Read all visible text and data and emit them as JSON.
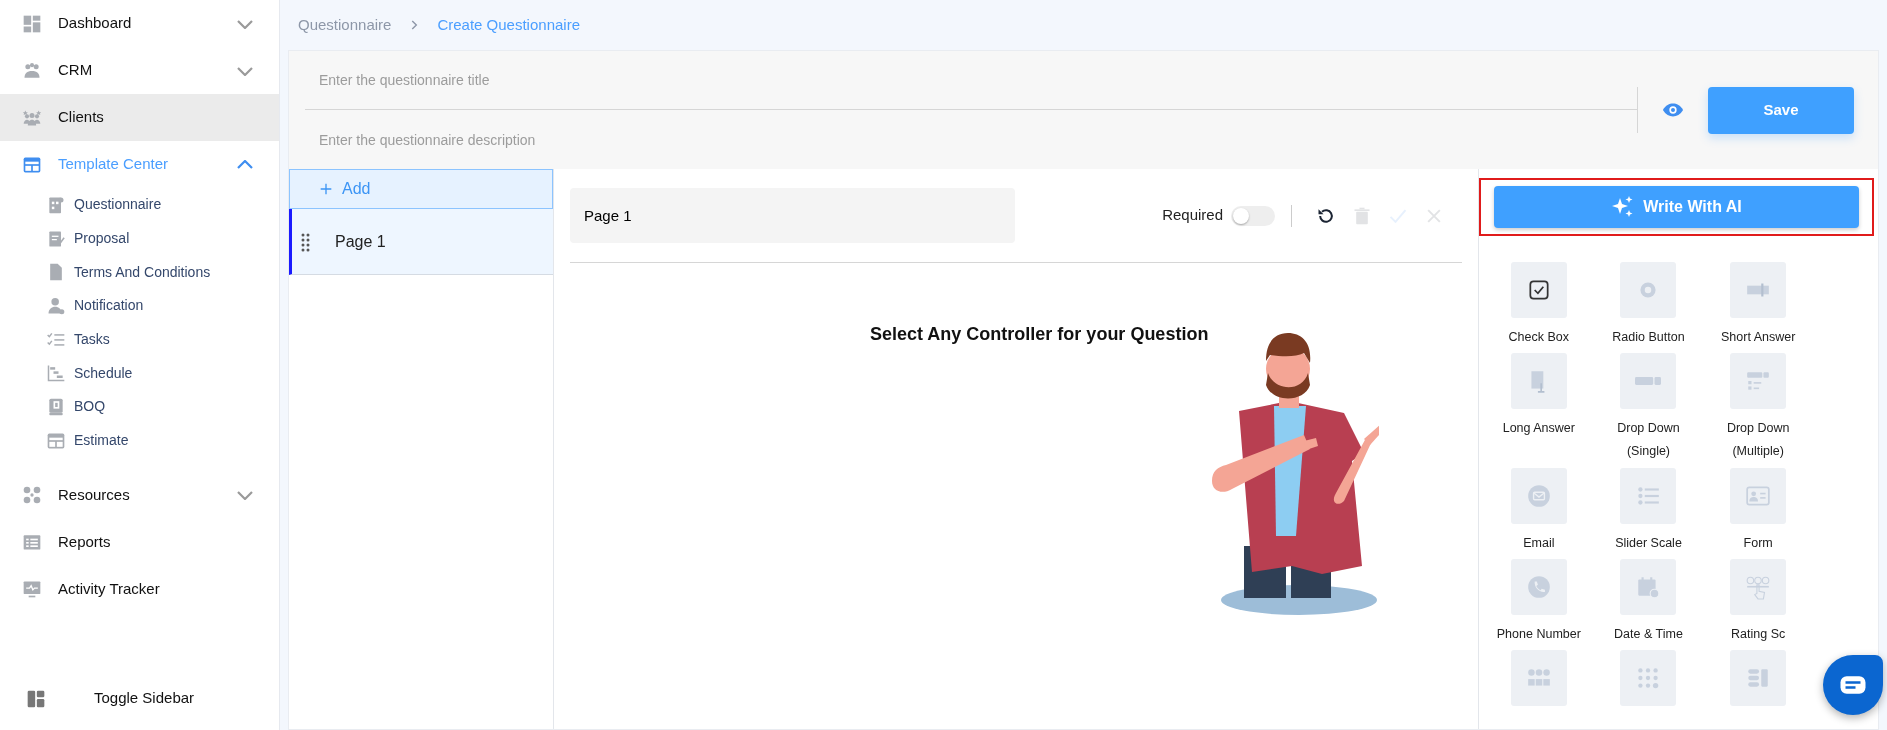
{
  "sidebar": {
    "items": [
      {
        "label": "Dashboard",
        "expanded": false,
        "selected": false
      },
      {
        "label": "CRM",
        "expanded": false,
        "selected": false
      },
      {
        "label": "Clients",
        "selected": true
      },
      {
        "label": "Template Center",
        "expanded": true,
        "selected": false,
        "children": [
          {
            "label": "Questionnaire",
            "selected": false
          },
          {
            "label": "Proposal",
            "selected": false
          },
          {
            "label": "Terms And Conditions",
            "selected": false
          },
          {
            "label": "Notification",
            "selected": false
          },
          {
            "label": "Tasks",
            "selected": false
          },
          {
            "label": "Schedule",
            "selected": false
          },
          {
            "label": "BOQ",
            "selected": false
          },
          {
            "label": "Estimate",
            "selected": false
          }
        ]
      },
      {
        "label": "Resources",
        "expanded": false,
        "selected": false
      },
      {
        "label": "Reports",
        "selected": false
      },
      {
        "label": "Activity Tracker",
        "selected": false
      }
    ],
    "toggle": {
      "label": "Toggle Sidebar"
    }
  },
  "breadcrumb": [
    {
      "label": "Questionnaire",
      "current": false
    },
    {
      "label": "Create Questionnaire",
      "current": true
    }
  ],
  "header": {
    "title_placeholder": "Enter the questionnaire title",
    "description_placeholder": "Enter the questionnaire description",
    "save": "Save"
  },
  "pages": {
    "add": "Add",
    "items": [
      {
        "label": "Page 1",
        "selected": true
      }
    ]
  },
  "editor": {
    "page_name": "Page 1",
    "required_label": "Required",
    "required": false,
    "actions": [
      {
        "kind": "reset",
        "disabled": false
      },
      {
        "kind": "delete",
        "disabled": true
      },
      {
        "kind": "confirm",
        "disabled": true
      },
      {
        "kind": "cancel",
        "disabled": true
      }
    ],
    "prompt": "Select Any Controller for your Question"
  },
  "controllers": {
    "ai_button": "Write With AI",
    "items": [
      {
        "label": "Check Box"
      },
      {
        "label": "Radio Button"
      },
      {
        "label": "Short Answer"
      },
      {
        "label": "Long Answer"
      },
      {
        "label": "Drop Down (Single)"
      },
      {
        "label": "Drop Down (Multiple)"
      },
      {
        "label": "Email"
      },
      {
        "label": "Slider Scale"
      },
      {
        "label": "Form"
      },
      {
        "label": "Phone Number"
      },
      {
        "label": "Date & Time"
      },
      {
        "label": "Rating Sc"
      },
      {
        "kind": "unlabeled"
      },
      {
        "kind": "unlabeled"
      },
      {
        "kind": "unlabeled"
      }
    ]
  }
}
